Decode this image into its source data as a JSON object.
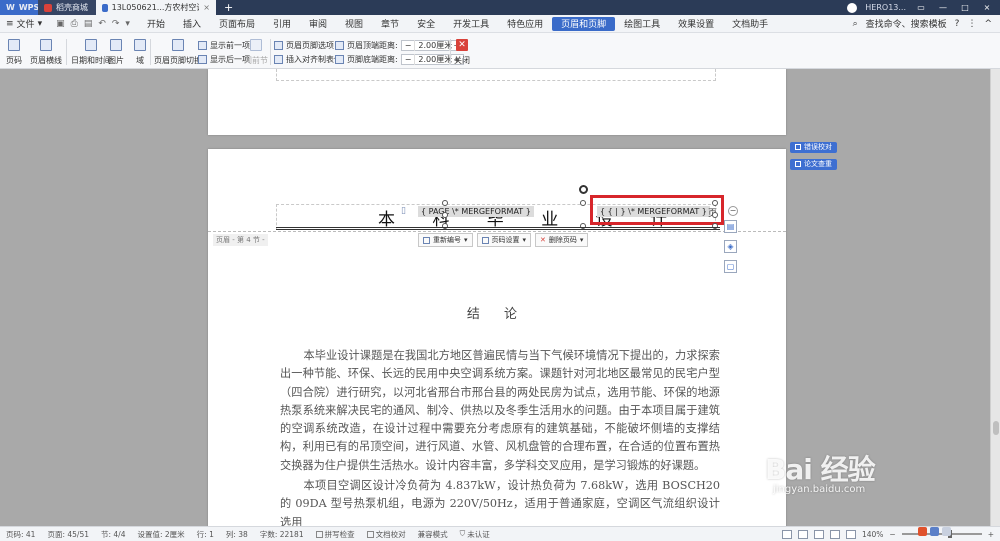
{
  "titlebar": {
    "tabs": [
      {
        "label": "WPS",
        "color": "#3a6bc9"
      },
      {
        "label": "稻壳商城",
        "color": "#d9423a"
      },
      {
        "label": "13L050621...方农村空调系统设计",
        "color": "#3a6bc9"
      }
    ],
    "user": "HERO13...",
    "add": "+"
  },
  "menubar": {
    "file": "文件",
    "items": [
      "开始",
      "插入",
      "页面布局",
      "引用",
      "审阅",
      "视图",
      "章节",
      "安全",
      "开发工具",
      "特色应用",
      "页眉和页脚",
      "绘图工具",
      "效果设置",
      "文档助手"
    ],
    "active_index": 10,
    "search": "查找命令、搜索模板"
  },
  "ribbon": {
    "page_number": "页码",
    "header_line": "页眉横线",
    "date_time": "日期和时间",
    "picture": "图片",
    "field": "域",
    "header_footer_switch": "页眉页脚切换",
    "show_prev": "显示前一项",
    "show_next": "显示后一项",
    "same_as_prev": "同前节",
    "header_footer_options": "页眉页脚选项",
    "insert_align_tab": "插入对齐制表位",
    "header_top_distance_label": "页眉顶端距离:",
    "header_top_distance": "2.00厘米",
    "footer_bottom_distance_label": "页脚底端距离:",
    "footer_bottom_distance": "2.00厘米",
    "close": "关闭"
  },
  "document": {
    "header_title": "本 科 毕 业 设 计",
    "field_left": "{ PAGE \\* MERGEFORMAT }",
    "field_right": "{ { | } \\* MERGEFORMAT }",
    "page_suffix": "页",
    "header_section_label": "页眉 - 第 4 节 -",
    "header_tools": [
      {
        "label": "重新编号"
      },
      {
        "label": "页码设置"
      },
      {
        "label": "删除页码"
      }
    ],
    "heading": "结 论",
    "paragraphs": [
      "本毕业设计课题是在我国北方地区普遍民情与当下气候环境情况下提出的，力求探索出一种节能、环保、长远的民用中央空调系统方案。课题针对河北地区最常见的民宅户型（四合院）进行研究，以河北省邢台市邢台县的两处民房为试点，选用节能、环保的地源热泵系统来解决民宅的通风、制冷、供热以及冬季生活用水的问题。由于本项目属于建筑的空调系统改造，在设计过程中需要充分考虑原有的建筑基础，不能破坏侧墙的支撑结构，利用已有的吊顶空间，进行风道、水管、风机盘管的合理布置，在合适的位置布置热交换器为住户提供生活热水。设计内容丰富，多学科交叉应用，是学习锻炼的好课题。",
      "本项目空调区设计冷负荷为 4.837kW，设计热负荷为 7.68kW，选用 BOSCH20 的 09DA 型号热泵机组，电源为 220V/50Hz，适用于普通家庭，空调区气流组织设计选用"
    ],
    "side_pills": [
      "错误校对",
      "论文查重"
    ]
  },
  "statusbar": {
    "page_num": "页码: 41",
    "pages": "页面: 45/51",
    "section": "节: 4/4",
    "setting": "设置值: 2厘米",
    "row": "行: 1",
    "col": "列: 38",
    "word_count": "字数: 22181",
    "spell_check": "拼写检查",
    "doc_proof": "文档校对",
    "compat_mode": "兼容模式",
    "not_certified": "未认证",
    "zoom": "140%"
  },
  "watermark": {
    "logo": "Bai 经验",
    "url": "jingyan.baidu.com"
  },
  "colors": {
    "titlebar": "#2b3b57",
    "accent": "#3a6bc9",
    "highlight_box": "#d7262b"
  }
}
